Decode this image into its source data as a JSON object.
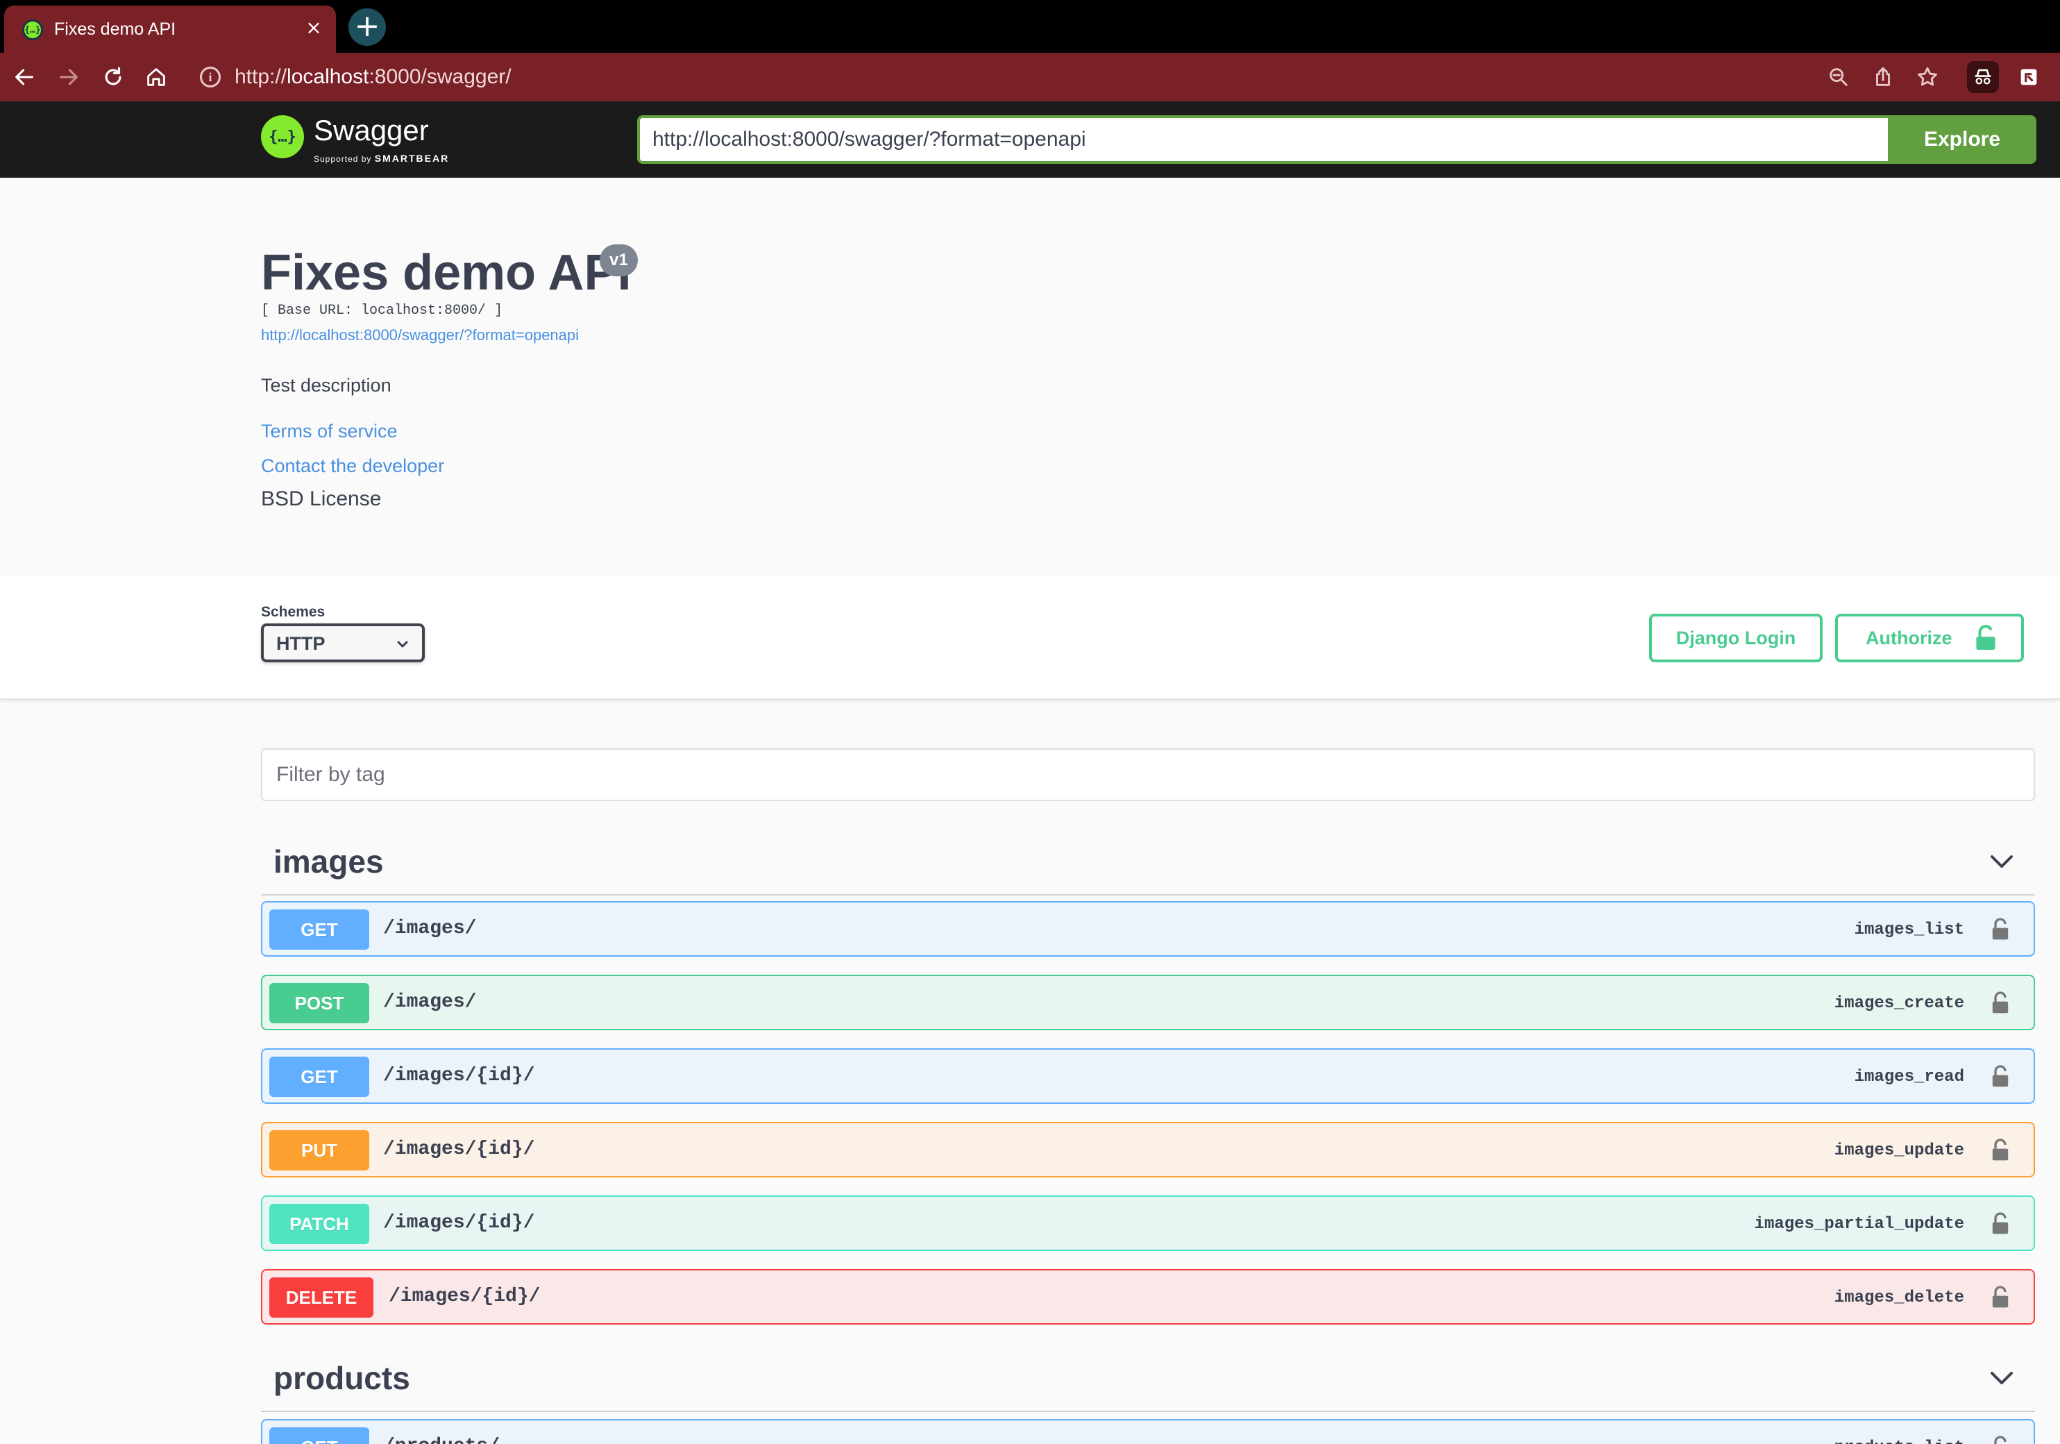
{
  "browser": {
    "tab_title": "Fixes demo API",
    "new_tab_symbol": "+",
    "close_symbol": "×",
    "url_prefix": "http://",
    "url_host": "localhost",
    "url_rest": ":8000/swagger/"
  },
  "topbar": {
    "logo_word": "Swagger",
    "logo_sub_small": "Supported by",
    "logo_sub_brand": "SMARTBEAR",
    "spec_url": "http://localhost:8000/swagger/?format=openapi",
    "explore_label": "Explore"
  },
  "info": {
    "title": "Fixes demo API",
    "version": "v1",
    "base_url": "[ Base URL: localhost:8000/ ]",
    "spec_link": "http://localhost:8000/swagger/?format=openapi",
    "description": "Test description",
    "terms": "Terms of service",
    "contact": "Contact the developer",
    "license": "BSD License"
  },
  "schemes": {
    "label": "Schemes",
    "value": "HTTP",
    "django_login": "Django Login",
    "authorize": "Authorize"
  },
  "filter": {
    "placeholder": "Filter by tag"
  },
  "tags": [
    {
      "name": "images",
      "operations": [
        {
          "method": "GET",
          "path": "/images/",
          "operation_id": "images_list"
        },
        {
          "method": "POST",
          "path": "/images/",
          "operation_id": "images_create"
        },
        {
          "method": "GET",
          "path": "/images/{id}/",
          "operation_id": "images_read"
        },
        {
          "method": "PUT",
          "path": "/images/{id}/",
          "operation_id": "images_update"
        },
        {
          "method": "PATCH",
          "path": "/images/{id}/",
          "operation_id": "images_partial_update"
        },
        {
          "method": "DELETE",
          "path": "/images/{id}/",
          "operation_id": "images_delete"
        }
      ]
    },
    {
      "name": "products",
      "operations": [
        {
          "method": "GET",
          "path": "/products/",
          "operation_id": "products_list"
        }
      ]
    }
  ],
  "colors": {
    "browser_frame": "#7a2127",
    "swagger_green": "#85ea2d",
    "get": "#61affe",
    "post": "#49cc90",
    "put": "#fca130",
    "patch": "#50e3c2",
    "delete": "#f93e3e",
    "link": "#4990e2"
  },
  "icons": {
    "back": "arrow-left-icon",
    "forward": "arrow-right-icon",
    "reload": "reload-icon",
    "home": "home-icon",
    "site_info": "info-icon",
    "zoom": "zoom-icon",
    "share": "share-icon",
    "bookmark": "star-icon",
    "extension": "extension-icon",
    "lock": "lock-icon",
    "chevron": "chevron-down-icon"
  }
}
